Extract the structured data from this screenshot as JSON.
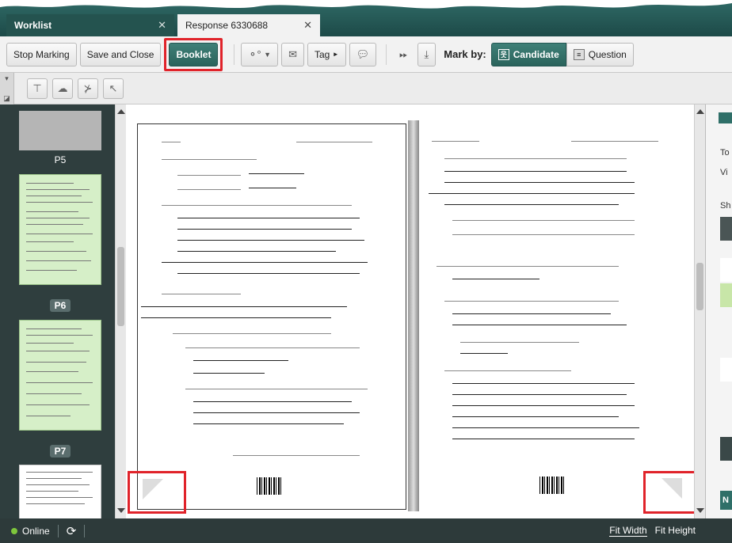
{
  "tabs": [
    {
      "label": "Worklist",
      "active": false
    },
    {
      "label": "Response 6330688",
      "active": true
    }
  ],
  "toolbar": {
    "stop_marking": "Stop Marking",
    "save_and_close": "Save and Close",
    "booklet": "Booklet",
    "tag": "Tag",
    "mark_by": "Mark by:",
    "candidate": "Candidate",
    "question": "Question"
  },
  "thumbnails": {
    "p5": "P5",
    "p6": "P6",
    "p7": "P7"
  },
  "right_panel": {
    "to": "To",
    "vi": "Vi",
    "sh": "Sh",
    "n": "N"
  },
  "status": {
    "online": "Online",
    "fit_width": "Fit Width",
    "fit_height": "Fit Height"
  },
  "colors": {
    "accent": "#2f6f68",
    "highlight": "#e0232a",
    "thumb_marked": "#d6efc8",
    "online": "#7ec63c"
  }
}
